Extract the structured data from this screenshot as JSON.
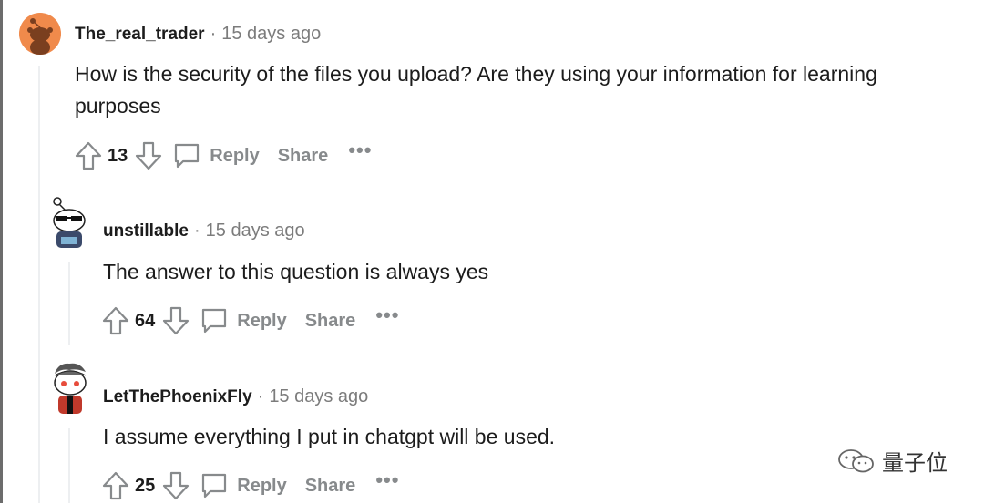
{
  "comments": [
    {
      "username": "The_real_trader",
      "time": "15 days ago",
      "body": "How is the security of the files you upload? Are they using your information for learning purposes",
      "score": "13",
      "reply_label": "Reply",
      "share_label": "Share",
      "more_label": "•••",
      "avatar_color": "#f08a4b"
    },
    {
      "username": "unstillable",
      "time": "15 days ago",
      "body": "The answer to this question is always yes",
      "score": "64",
      "reply_label": "Reply",
      "share_label": "Share",
      "more_label": "•••",
      "avatar_color": "#3b4a6b"
    },
    {
      "username": "LetThePhoenixFly",
      "time": "15 days ago",
      "body": "I assume everything I put in chatgpt will be used.",
      "score": "25",
      "reply_label": "Reply",
      "share_label": "Share",
      "more_label": "•••",
      "avatar_color": "#c0392b"
    }
  ],
  "separator": "·",
  "watermark": {
    "text": "量子位"
  },
  "colors": {
    "action_gray": "#878a8c",
    "meta_gray": "#7c7c7c",
    "thread_line": "#edeff1"
  }
}
